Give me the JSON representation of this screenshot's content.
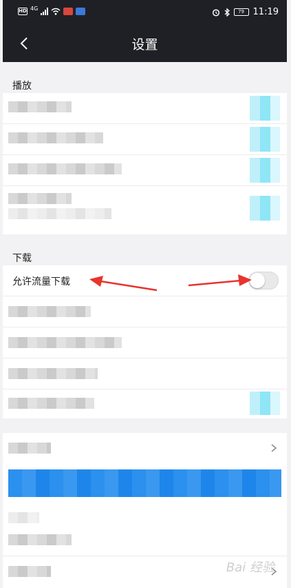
{
  "status_bar": {
    "hd": "HD",
    "network": "4G",
    "battery": "79",
    "time": "11:19"
  },
  "header": {
    "title": "设置",
    "back_icon": "chevron-left-icon"
  },
  "sections": {
    "play": {
      "label": "播放"
    },
    "download": {
      "label": "下载",
      "allow_cellular_label": "允许流量下载",
      "allow_cellular_enabled": false
    }
  },
  "colors": {
    "header_bg": "#1f2026",
    "page_bg": "#f2f2f4",
    "annotation_red": "#e8342c",
    "accent_blue": "#2b90ee"
  },
  "watermark": "Bai 经验"
}
